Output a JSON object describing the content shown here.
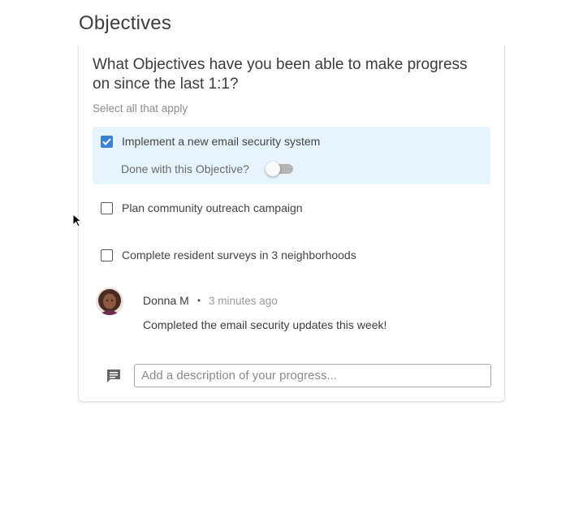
{
  "page": {
    "title": "Objectives"
  },
  "question": {
    "text": "What Objectives have you been able to make progress on since the last 1:1?",
    "hint": "Select all that apply"
  },
  "options": [
    {
      "label": "Implement a new email security system",
      "checked": true,
      "done_label": "Done with this Objective?",
      "done": false
    },
    {
      "label": "Plan community outreach campaign",
      "checked": false
    },
    {
      "label": "Complete resident surveys in 3 neighborhoods",
      "checked": false
    }
  ],
  "comment": {
    "author": "Donna M",
    "separator": "•",
    "time": "3 minutes ago",
    "text": "Completed the email security updates this week!",
    "avatar": "user-avatar"
  },
  "progress_input": {
    "placeholder": "Add a description of your progress...",
    "value": "",
    "icon": "comment-icon"
  },
  "colors": {
    "accent": "#3b82d6",
    "selected_bg": "#e6f4fd",
    "toggle_track": "#b5b5b5"
  }
}
